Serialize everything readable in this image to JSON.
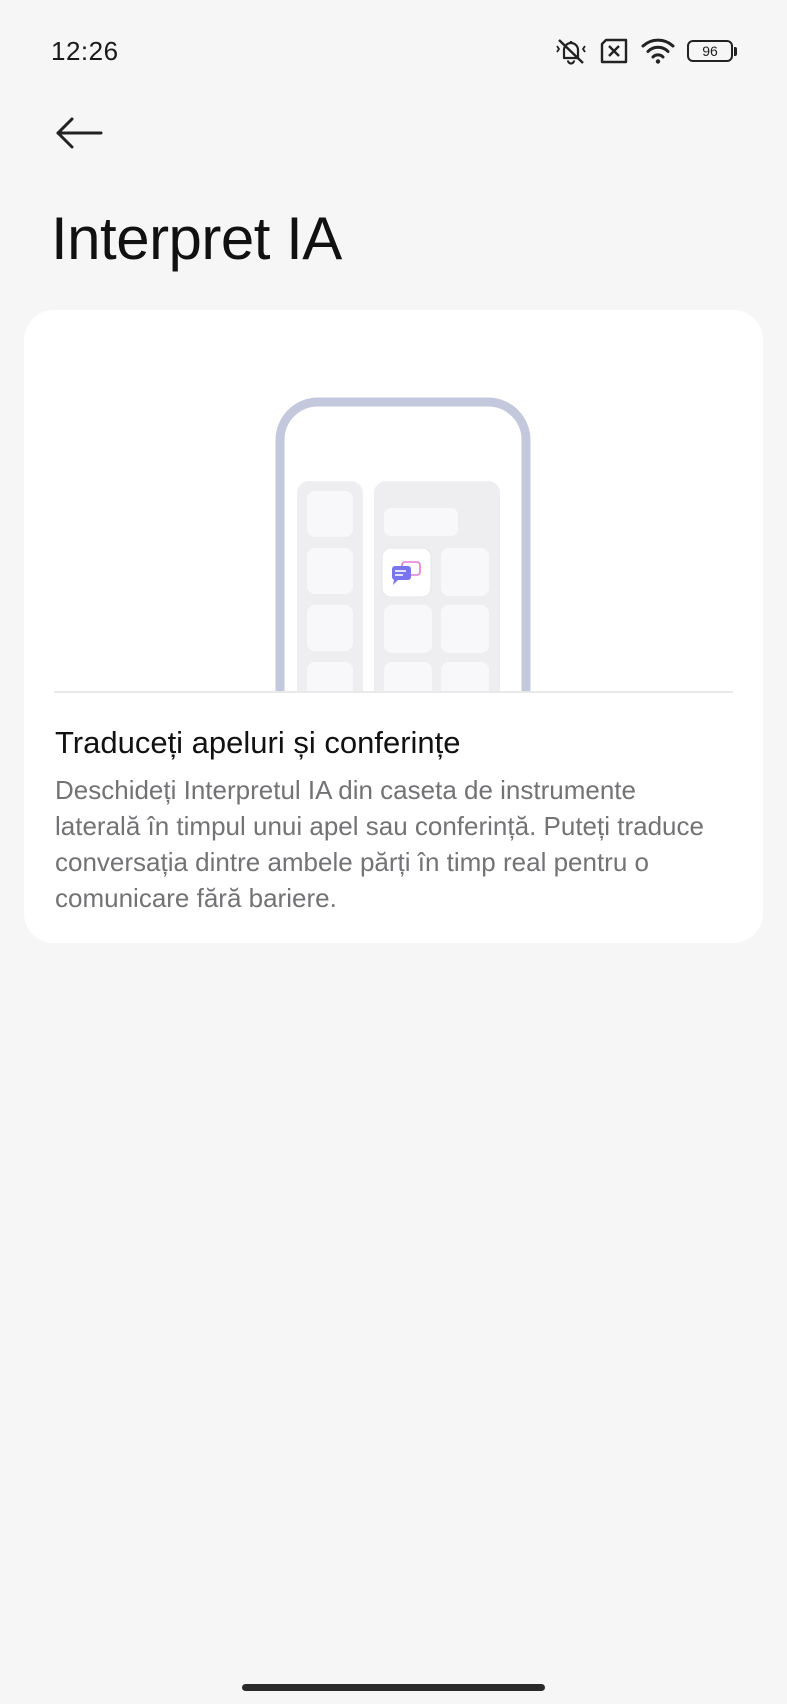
{
  "status_bar": {
    "time": "12:26",
    "battery_level": "96",
    "icons": [
      "mute-vibrate-icon",
      "no-sim-icon",
      "wifi-icon",
      "battery-icon"
    ]
  },
  "header": {
    "back_icon": "arrow-left-icon",
    "title": "Interpret IA"
  },
  "card": {
    "illustration": "phone-sidebar-toolbox-illustration",
    "app_icon": "chat-translate-icon",
    "heading": "Traduceți apeluri și conferințe",
    "body": "Deschideți Interpretul IA din caseta de instrumente laterală în timpul unui apel sau conferință. Puteți traduce conversația dintre ambele părți în timp real pentru o comunicare fără bariere."
  },
  "colors": {
    "background": "#f6f6f7",
    "card": "#ffffff",
    "phone_frame": "#c3c8dc",
    "panel": "#eeeef1",
    "tile": "#f8f8fa",
    "body_text": "#737376",
    "icon_accent_blue": "#5b8cf5",
    "icon_accent_pink": "#e67ad3"
  }
}
